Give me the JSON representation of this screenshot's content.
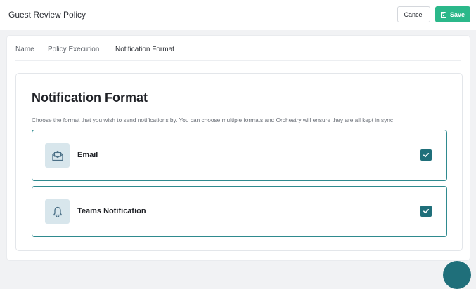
{
  "header": {
    "title": "Guest Review Policy",
    "cancel_label": "Cancel",
    "save_label": "Save"
  },
  "tabs": [
    {
      "label": "Name",
      "active": false
    },
    {
      "label": "Policy Execution",
      "active": false
    },
    {
      "label": "Notification Format",
      "active": true
    }
  ],
  "section": {
    "title": "Notification Format",
    "description": "Choose the format that you wish to send notifications by. You can choose multiple formats and Orchestry will ensure they are all kept in sync",
    "options": [
      {
        "label": "Email",
        "icon": "envelope-icon",
        "checked": true
      },
      {
        "label": "Teams Notification",
        "icon": "bell-icon",
        "checked": true
      }
    ]
  },
  "colors": {
    "accent": "#2bb88a",
    "checkbox": "#1f6f7a",
    "option_border": "#2f8a8f",
    "icon_bg": "#d8e6ec"
  }
}
